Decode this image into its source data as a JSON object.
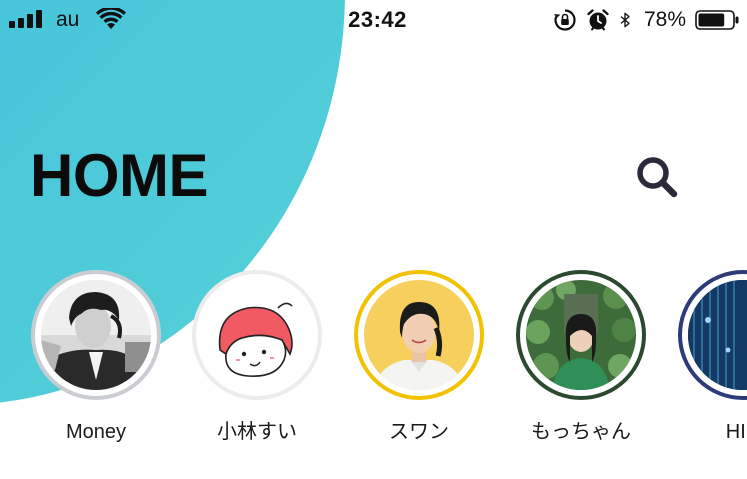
{
  "status_bar": {
    "carrier": "au",
    "time": "23:42",
    "battery_percent": "78%",
    "battery_level": 0.78,
    "icons": [
      "signal-icon",
      "wifi-icon",
      "rotation-lock-icon",
      "alarm-icon",
      "bluetooth-icon",
      "battery-icon"
    ]
  },
  "header": {
    "title": "HOME",
    "search_icon": "search-icon"
  },
  "stories": [
    {
      "name": "Money",
      "ring_color": "#c9cdd2"
    },
    {
      "name": "小林すい",
      "ring_color": "#ececec"
    },
    {
      "name": "スワン",
      "ring_color": "#f2c200"
    },
    {
      "name": "もっちゃん",
      "ring_color": "#2c4a2f"
    },
    {
      "name": "HIN",
      "ring_color": "#2d3b78"
    }
  ],
  "colors": {
    "accent_gradient_start": "#3aa6e6",
    "accent_gradient_end": "#55d2d6",
    "title": "#0b0b0b",
    "search_icon": "#2a2a3a"
  }
}
